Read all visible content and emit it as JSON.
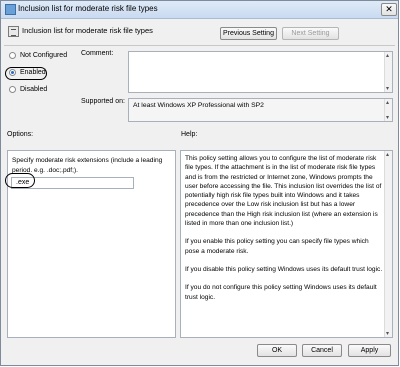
{
  "window": {
    "title": "Inclusion list for moderate risk file types",
    "close_glyph": "✕"
  },
  "header": {
    "title": "Inclusion list for moderate risk file types"
  },
  "nav": {
    "previous": "Previous Setting",
    "next": "Next Setting"
  },
  "state": {
    "options": [
      "Not Configured",
      "Enabled",
      "Disabled"
    ],
    "selected": "Enabled"
  },
  "comment": {
    "label": "Comment:",
    "value": ""
  },
  "supported": {
    "label": "Supported on:",
    "value": "At least Windows XP Professional with SP2"
  },
  "options_section": {
    "label": "Options:",
    "description": "Specify moderate risk extensions (include a leading period. e.g. .doc;.pdf;).",
    "input_value": ".exe"
  },
  "help_section": {
    "label": "Help:",
    "paragraphs": [
      "This policy setting allows you to configure the list of moderate risk file types. If the attachment is in the list of moderate risk file types and is from the restricted or Internet zone, Windows prompts the user before accessing the file. This inclusion list overrides the list of potentially high risk file types built into Windows and it takes precedence over the Low risk inclusion list but has a lower precedence than the High risk inclusion list (where an extension is listed in more than one inclusion list.)",
      "If you enable this policy setting you can specify file types which pose a moderate risk.",
      "If you disable this policy setting Windows uses its default trust logic.",
      "If you do not configure this policy setting Windows uses its default trust logic."
    ]
  },
  "buttons": {
    "ok": "OK",
    "cancel": "Cancel",
    "apply": "Apply"
  },
  "icons": [
    "app-icon",
    "policy-icon",
    "close-icon",
    "scroll-up-icon",
    "scroll-down-icon"
  ]
}
